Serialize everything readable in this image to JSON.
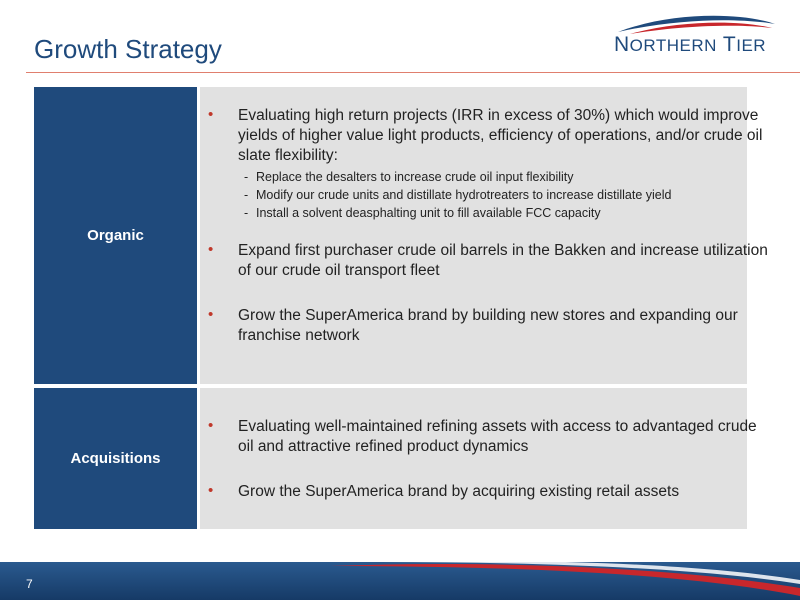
{
  "slide": {
    "title": "Growth Strategy",
    "page_number": "7"
  },
  "logo": {
    "text_n": "N",
    "text_orthern": "ORTHERN",
    "text_t": "T",
    "text_ier": "IER"
  },
  "rows": [
    {
      "label": "Organic",
      "bullets": [
        {
          "text": "Evaluating high return projects (IRR in excess of 30%) which would improve yields of higher value light products, efficiency of operations, and/or crude oil slate flexibility:",
          "subs": [
            "Replace the desalters to increase crude oil input flexibility",
            "Modify our crude units and distillate hydrotreaters to increase distillate yield",
            "Install a solvent deasphalting unit to fill available FCC capacity"
          ]
        },
        {
          "text": "Expand first purchaser crude oil barrels in the Bakken and increase utilization of our crude oil transport fleet"
        },
        {
          "text": "Grow the SuperAmerica brand by building new stores and expanding our franchise network"
        }
      ]
    },
    {
      "label": "Acquisitions",
      "bullets": [
        {
          "text": "Evaluating well-maintained refining assets with access to advantaged crude oil and attractive refined product dynamics"
        },
        {
          "text": "Grow the SuperAmerica brand by acquiring existing retail assets"
        }
      ]
    }
  ],
  "colors": {
    "brand_blue": "#1f4a7c",
    "bullet_red": "#c0392b",
    "cell_gray": "#e1e1e1"
  }
}
